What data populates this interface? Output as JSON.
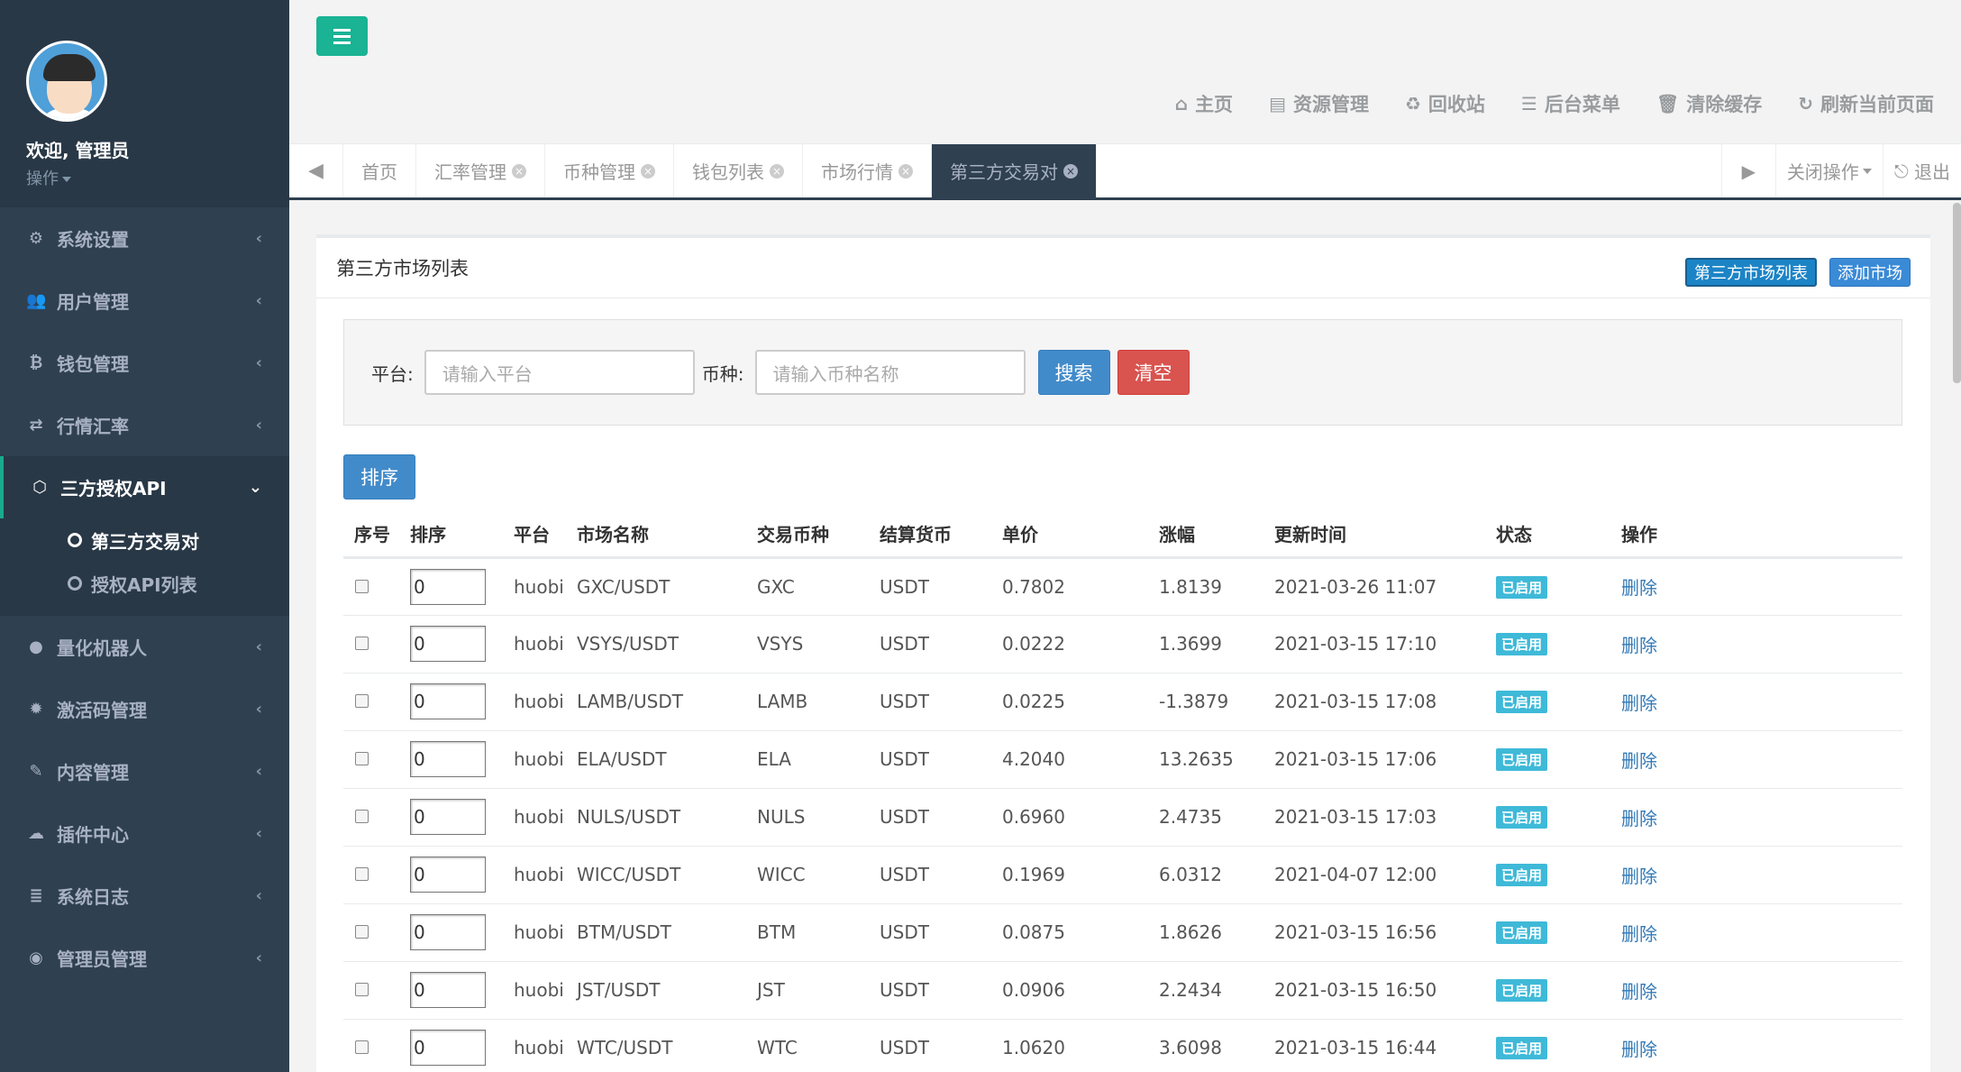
{
  "colors": {
    "sidebar": "#2f4050",
    "accent": "#1ab394",
    "primary": "#428bca",
    "danger": "#d9534f"
  },
  "profile": {
    "welcome": "欢迎, 管理员",
    "operation": "操作"
  },
  "sidebar": {
    "items": [
      {
        "label": "系统设置",
        "icon": "gears-icon"
      },
      {
        "label": "用户管理",
        "icon": "users-icon"
      },
      {
        "label": "钱包管理",
        "icon": "bitcoin-icon"
      },
      {
        "label": "行情汇率",
        "icon": "exchange-icon"
      },
      {
        "label": "三方授权API",
        "icon": "cube-icon",
        "expanded": true
      },
      {
        "label": "量化机器人",
        "icon": "android-icon"
      },
      {
        "label": "激活码管理",
        "icon": "gear-icon"
      },
      {
        "label": "内容管理",
        "icon": "edit-icon"
      },
      {
        "label": "插件中心",
        "icon": "cloud-icon"
      },
      {
        "label": "系统日志",
        "icon": "database-icon"
      },
      {
        "label": "管理员管理",
        "icon": "user-circle-icon"
      }
    ],
    "submenu": [
      "第三方交易对",
      "授权API列表"
    ]
  },
  "topnav": [
    "主页",
    "资源管理",
    "回收站",
    "后台菜单",
    "清除缓存",
    "刷新当前页面"
  ],
  "tabs": [
    "首页",
    "汇率管理",
    "币种管理",
    "钱包列表",
    "市场行情",
    "第三方交易对"
  ],
  "tabs_right": {
    "close_ops": "关闭操作",
    "logout": "退出"
  },
  "panel": {
    "title": "第三方市场列表",
    "btn_list": "第三方市场列表",
    "btn_add": "添加市场"
  },
  "search": {
    "platform_label": "平台:",
    "platform_placeholder": "请输入平台",
    "coin_label": "币种:",
    "coin_placeholder": "请输入币种名称",
    "search_btn": "搜索",
    "clear_btn": "清空"
  },
  "sort_btn": "排序",
  "table": {
    "headers": [
      "序号",
      "排序",
      "平台",
      "市场名称",
      "交易币种",
      "结算货币",
      "单价",
      "涨幅",
      "更新时间",
      "状态",
      "操作"
    ],
    "rows": [
      [
        "0",
        "huobi",
        "GXC/USDT",
        "GXC",
        "USDT",
        "0.7802",
        "1.8139",
        "2021-03-26 11:07",
        "已启用",
        "删除"
      ],
      [
        "0",
        "huobi",
        "VSYS/USDT",
        "VSYS",
        "USDT",
        "0.0222",
        "1.3699",
        "2021-03-15 17:10",
        "已启用",
        "删除"
      ],
      [
        "0",
        "huobi",
        "LAMB/USDT",
        "LAMB",
        "USDT",
        "0.0225",
        "-1.3879",
        "2021-03-15 17:08",
        "已启用",
        "删除"
      ],
      [
        "0",
        "huobi",
        "ELA/USDT",
        "ELA",
        "USDT",
        "4.2040",
        "13.2635",
        "2021-03-15 17:06",
        "已启用",
        "删除"
      ],
      [
        "0",
        "huobi",
        "NULS/USDT",
        "NULS",
        "USDT",
        "0.6960",
        "2.4735",
        "2021-03-15 17:03",
        "已启用",
        "删除"
      ],
      [
        "0",
        "huobi",
        "WICC/USDT",
        "WICC",
        "USDT",
        "0.1969",
        "6.0312",
        "2021-04-07 12:00",
        "已启用",
        "删除"
      ],
      [
        "0",
        "huobi",
        "BTM/USDT",
        "BTM",
        "USDT",
        "0.0875",
        "1.8626",
        "2021-03-15 16:56",
        "已启用",
        "删除"
      ],
      [
        "0",
        "huobi",
        "JST/USDT",
        "JST",
        "USDT",
        "0.0906",
        "2.2434",
        "2021-03-15 16:50",
        "已启用",
        "删除"
      ],
      [
        "0",
        "huobi",
        "WTC/USDT",
        "WTC",
        "USDT",
        "1.0620",
        "3.6098",
        "2021-03-15 16:44",
        "已启用",
        "删除"
      ]
    ]
  }
}
